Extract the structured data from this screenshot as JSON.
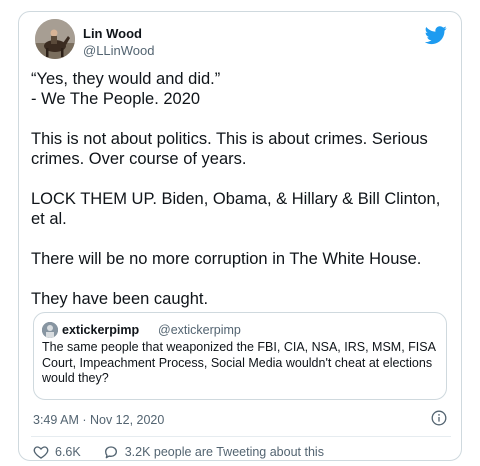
{
  "author": {
    "name": "Lin Wood",
    "handle": "@LLinWood"
  },
  "tweet_text": "“Yes, they would and did.”\n- We The People. 2020\n\nThis is not about politics. This is about crimes. Serious crimes. Over course of years.\n\nLOCK THEM UP. Biden, Obama, & Hillary & Bill Clinton, et al.\n\nThere will be no more corruption in The White House.\n\nThey have been caught.",
  "quoted_tweet": {
    "name": "extickerpimp",
    "handle": "@extickerpimp",
    "text": "The same people that weaponized the FBI, CIA, NSA, IRS, MSM, FISA Court, Impeachment Process, Social Media wouldn't cheat at elections would they?"
  },
  "timestamp": "3:49 AM · Nov 12, 2020",
  "stats": {
    "likes": "6.6K",
    "replies_text": "3.2K people are Tweeting about this"
  },
  "colors": {
    "twitter_blue": "#1d9bf0",
    "text_secondary": "#536471",
    "border": "#cfd9de"
  },
  "icons": [
    "twitter-bird-icon",
    "info-icon",
    "heart-icon",
    "comment-icon"
  ]
}
